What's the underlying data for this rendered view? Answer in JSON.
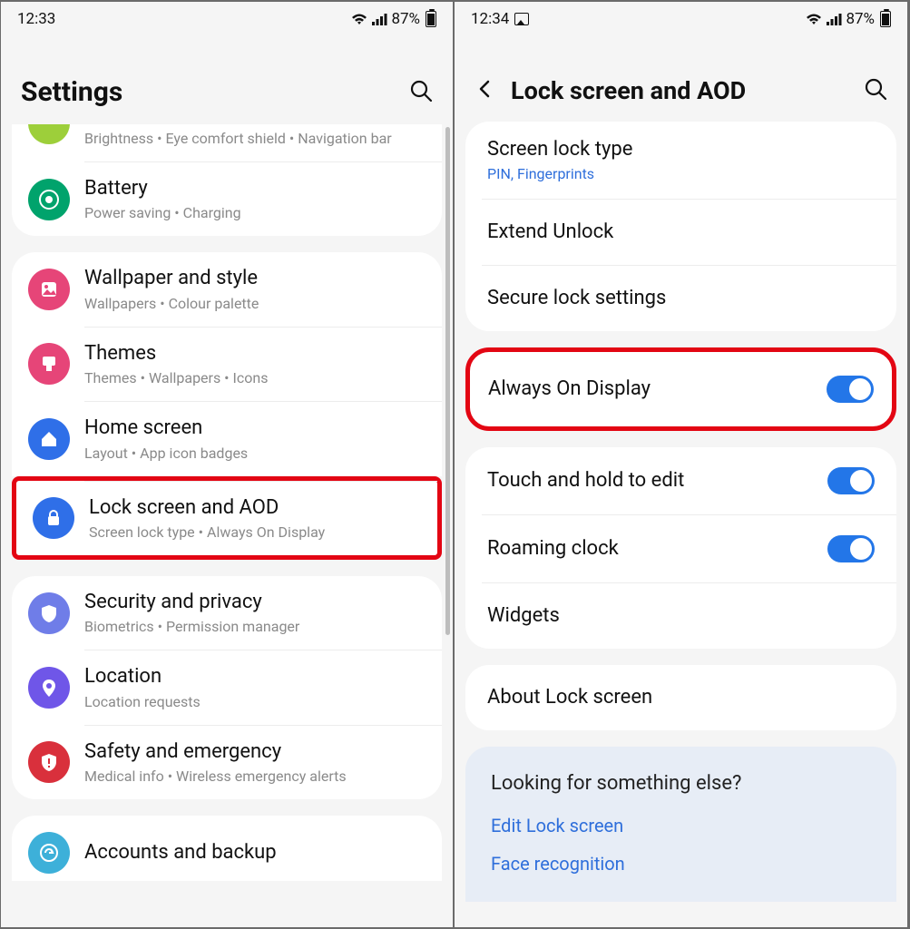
{
  "left": {
    "status": {
      "time": "12:33",
      "battery": "87%"
    },
    "header": {
      "title": "Settings"
    },
    "partialTop": {
      "sub": "Brightness  •  Eye comfort shield  •  Navigation bar"
    },
    "battery": {
      "title": "Battery",
      "sub": "Power saving  •  Charging"
    },
    "wallpaper": {
      "title": "Wallpaper and style",
      "sub": "Wallpapers  •  Colour palette"
    },
    "themes": {
      "title": "Themes",
      "sub": "Themes  •  Wallpapers  •  Icons"
    },
    "home": {
      "title": "Home screen",
      "sub": "Layout  •  App icon badges"
    },
    "lock": {
      "title": "Lock screen and AOD",
      "sub": "Screen lock type  •  Always On Display"
    },
    "security": {
      "title": "Security and privacy",
      "sub": "Biometrics  •  Permission manager"
    },
    "location": {
      "title": "Location",
      "sub": "Location requests"
    },
    "safety": {
      "title": "Safety and emergency",
      "sub": "Medical info  •  Wireless emergency alerts"
    },
    "accounts": {
      "title": "Accounts and backup"
    }
  },
  "right": {
    "status": {
      "time": "12:34",
      "battery": "87%"
    },
    "header": {
      "title": "Lock screen and AOD"
    },
    "screenlock": {
      "title": "Screen lock type",
      "sub": "PIN, Fingerprints"
    },
    "extend": {
      "title": "Extend Unlock"
    },
    "secure": {
      "title": "Secure lock settings"
    },
    "aod": {
      "title": "Always On Display",
      "toggle": true
    },
    "touch": {
      "title": "Touch and hold to edit",
      "toggle": true
    },
    "roaming": {
      "title": "Roaming clock",
      "toggle": true
    },
    "widgets": {
      "title": "Widgets"
    },
    "about": {
      "title": "About Lock screen"
    },
    "lookfor": {
      "title": "Looking for something else?",
      "link1": "Edit Lock screen",
      "link2": "Face recognition"
    }
  }
}
